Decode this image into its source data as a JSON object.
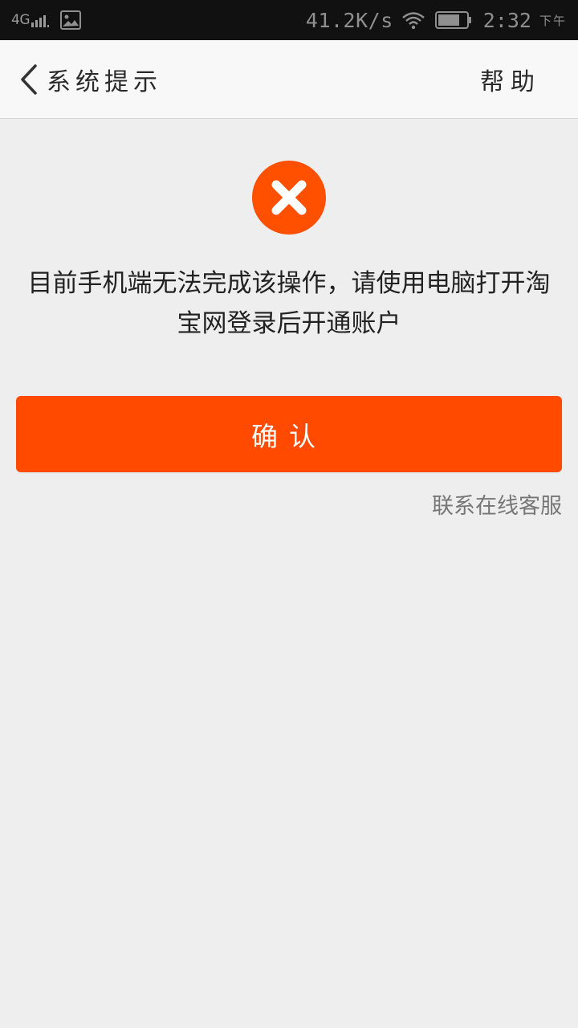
{
  "status_bar": {
    "network": "4G",
    "network_speed": "41.2K/s",
    "time": "2:32",
    "ampm": "下午"
  },
  "nav": {
    "title": "系统提示",
    "help_label": "帮助"
  },
  "content": {
    "message_line1": "目前手机端无法完成该操作，请使用电脑打开淘",
    "message_line2": "宝网登录后开通账户",
    "confirm_label": "确认",
    "contact_label": "联系在线客服"
  },
  "colors": {
    "accent": "#ff4a00",
    "error_icon": "#ff5000"
  }
}
